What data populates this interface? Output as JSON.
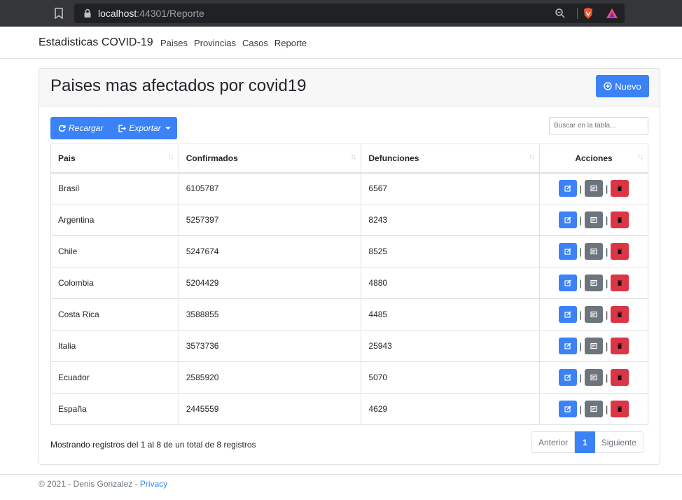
{
  "browser": {
    "url_host": "localhost",
    "url_rest": ":44301/Reporte"
  },
  "navbar": {
    "brand": "Estadisticas COVID-19",
    "links": [
      "Paises",
      "Provincias",
      "Casos",
      "Reporte"
    ]
  },
  "card": {
    "title": "Paises mas afectados por covid19",
    "new_button": "Nuevo"
  },
  "toolbar": {
    "reload_label": "Recargar",
    "export_label": "Exportar",
    "search_placeholder": "Buscar en la tabla..."
  },
  "table": {
    "headers": [
      "Pais",
      "Confirmados",
      "Defunciones",
      "Acciones"
    ],
    "rows": [
      [
        "Brasil",
        "6105787",
        "6567"
      ],
      [
        "Argentina",
        "5257397",
        "8243"
      ],
      [
        "Chile",
        "5247674",
        "8525"
      ],
      [
        "Colombia",
        "5204429",
        "4880"
      ],
      [
        "Costa Rica",
        "3588855",
        "4485"
      ],
      [
        "Italia",
        "3573736",
        "25943"
      ],
      [
        "Ecuador",
        "2585920",
        "5070"
      ],
      [
        "España",
        "2445559",
        "4629"
      ]
    ],
    "action_separator": "|"
  },
  "footer_table": {
    "info": "Mostrando registros del 1 al 8 de un total de 8 registros",
    "prev": "Anterior",
    "page": "1",
    "next": "Siguiente"
  },
  "footer": {
    "text": "© 2021 - Denis Gonzalez - ",
    "link": "Privacy"
  },
  "colors": {
    "primary": "#3b82f6",
    "secondary": "#6c757d",
    "danger": "#dc3545"
  }
}
